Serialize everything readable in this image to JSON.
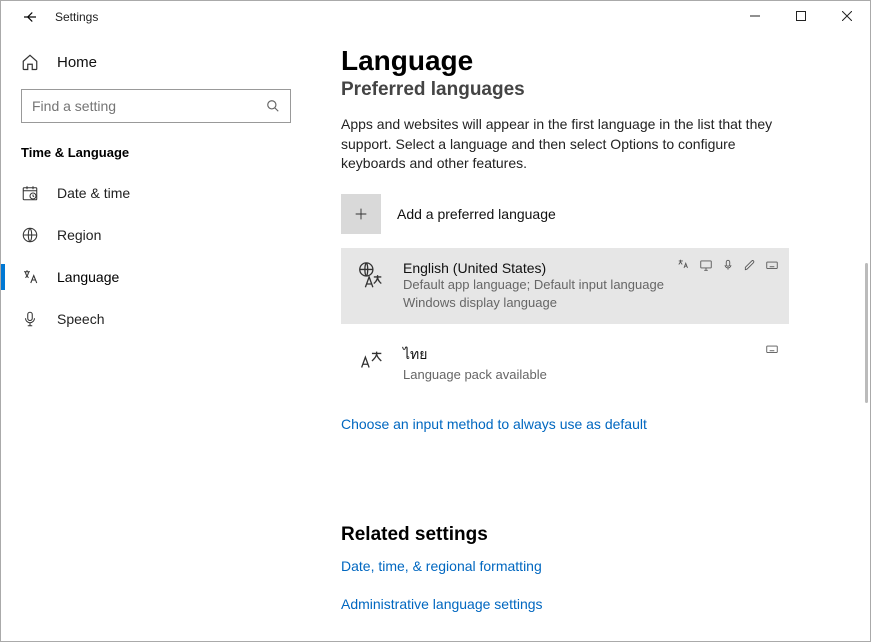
{
  "titlebar": {
    "title": "Settings"
  },
  "sidebar": {
    "home_label": "Home",
    "search_placeholder": "Find a setting",
    "section_header": "Time & Language",
    "items": [
      {
        "label": "Date & time"
      },
      {
        "label": "Region"
      },
      {
        "label": "Language"
      },
      {
        "label": "Speech"
      }
    ]
  },
  "main": {
    "page_title": "Language",
    "sub_header": "Preferred languages",
    "description": "Apps and websites will appear in the first language in the list that they support. Select a language and then select Options to configure keyboards and other features.",
    "add_label": "Add a preferred language",
    "languages": [
      {
        "name": "English (United States)",
        "sub1": "Default app language; Default input language",
        "sub2": "Windows display language"
      },
      {
        "name": "ไทย",
        "sub1": "Language pack available",
        "sub2": ""
      }
    ],
    "input_method_link": "Choose an input method to always use as default",
    "related_header": "Related settings",
    "related_links": [
      "Date, time, & regional formatting",
      "Administrative language settings"
    ]
  }
}
